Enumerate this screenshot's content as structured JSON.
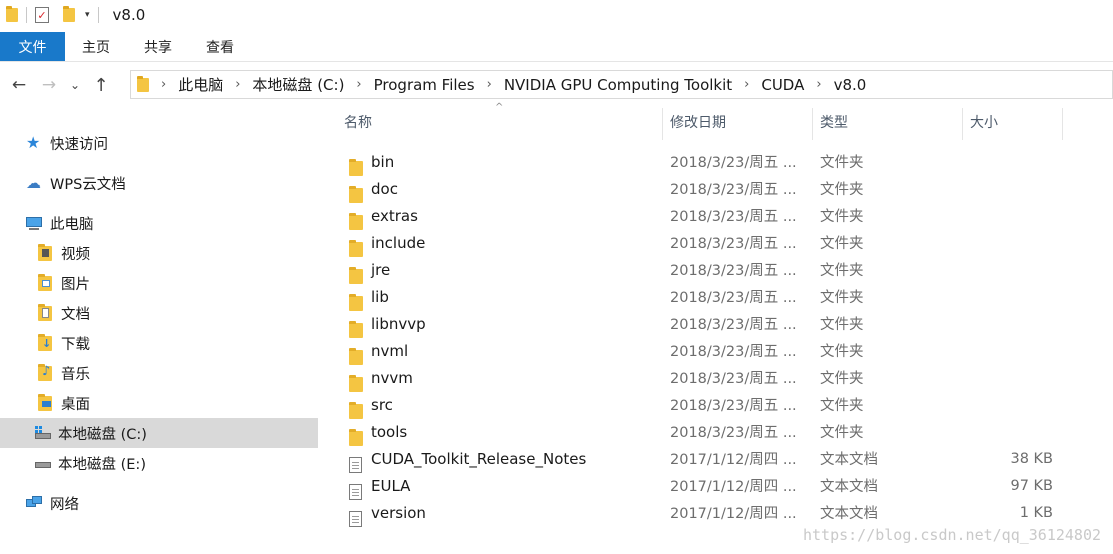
{
  "window": {
    "title": "v8.0"
  },
  "ribbon": {
    "tabs": [
      "文件",
      "主页",
      "共享",
      "查看"
    ]
  },
  "address": {
    "crumbs": [
      "此电脑",
      "本地磁盘 (C:)",
      "Program Files",
      "NVIDIA GPU Computing Toolkit",
      "CUDA",
      "v8.0"
    ]
  },
  "sidebar": {
    "quick_access": "快速访问",
    "wps": "WPS云文档",
    "this_pc": "此电脑",
    "items": [
      "视频",
      "图片",
      "文档",
      "下载",
      "音乐",
      "桌面"
    ],
    "drive_c": "本地磁盘 (C:)",
    "drive_e": "本地磁盘 (E:)",
    "network": "网络"
  },
  "columns": {
    "name": "名称",
    "date": "修改日期",
    "type": "类型",
    "size": "大小"
  },
  "files": [
    {
      "name": "bin",
      "date": "2018/3/23/周五 ...",
      "type": "文件夹",
      "size": "",
      "icon": "folder-icon"
    },
    {
      "name": "doc",
      "date": "2018/3/23/周五 ...",
      "type": "文件夹",
      "size": "",
      "icon": "folder-icon"
    },
    {
      "name": "extras",
      "date": "2018/3/23/周五 ...",
      "type": "文件夹",
      "size": "",
      "icon": "folder-icon"
    },
    {
      "name": "include",
      "date": "2018/3/23/周五 ...",
      "type": "文件夹",
      "size": "",
      "icon": "folder-icon"
    },
    {
      "name": "jre",
      "date": "2018/3/23/周五 ...",
      "type": "文件夹",
      "size": "",
      "icon": "folder-icon"
    },
    {
      "name": "lib",
      "date": "2018/3/23/周五 ...",
      "type": "文件夹",
      "size": "",
      "icon": "folder-icon"
    },
    {
      "name": "libnvvp",
      "date": "2018/3/23/周五 ...",
      "type": "文件夹",
      "size": "",
      "icon": "folder-icon"
    },
    {
      "name": "nvml",
      "date": "2018/3/23/周五 ...",
      "type": "文件夹",
      "size": "",
      "icon": "folder-icon"
    },
    {
      "name": "nvvm",
      "date": "2018/3/23/周五 ...",
      "type": "文件夹",
      "size": "",
      "icon": "folder-icon"
    },
    {
      "name": "src",
      "date": "2018/3/23/周五 ...",
      "type": "文件夹",
      "size": "",
      "icon": "folder-icon"
    },
    {
      "name": "tools",
      "date": "2018/3/23/周五 ...",
      "type": "文件夹",
      "size": "",
      "icon": "folder-icon"
    },
    {
      "name": "CUDA_Toolkit_Release_Notes",
      "date": "2017/1/12/周四 ...",
      "type": "文本文档",
      "size": "38 KB",
      "icon": "text-file-icon"
    },
    {
      "name": "EULA",
      "date": "2017/1/12/周四 ...",
      "type": "文本文档",
      "size": "97 KB",
      "icon": "text-file-icon"
    },
    {
      "name": "version",
      "date": "2017/1/12/周四 ...",
      "type": "文本文档",
      "size": "1 KB",
      "icon": "text-file-icon"
    }
  ],
  "watermark": "https://blog.csdn.net/qq_36124802",
  "colors": {
    "accent": "#1979ca",
    "selected_bg": "#d9d9d9",
    "folder": "#f4c542"
  }
}
